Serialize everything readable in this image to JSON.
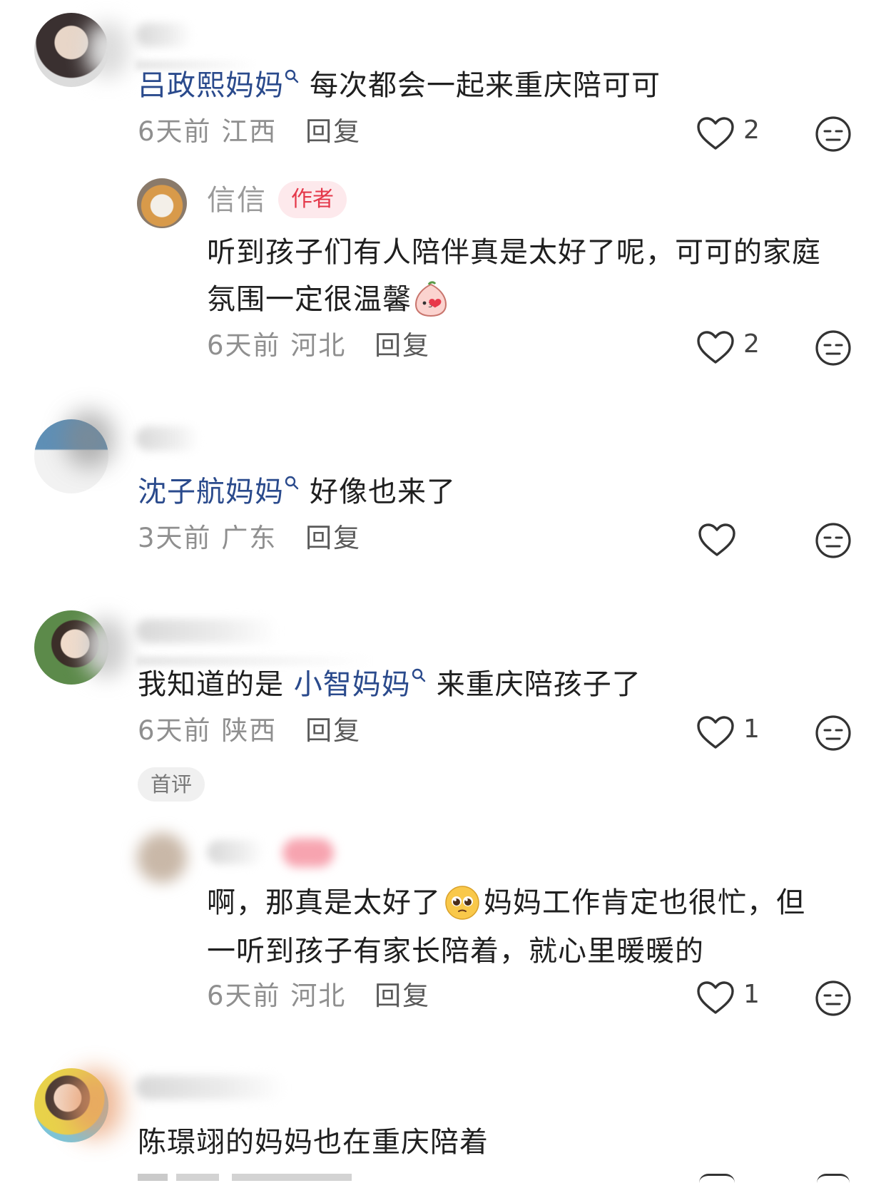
{
  "comments": [
    {
      "mention": "吕政熙妈妈",
      "text": "每次都会一起来重庆陪可可",
      "time": "6天前",
      "location": "江西",
      "reply_label": "回复",
      "likes": "2",
      "reply": {
        "author": "信信",
        "badge": "作者",
        "line1": "听到孩子们有人陪伴真是太好了呢，可可的家庭",
        "line2": "氛围一定很温馨",
        "time": "6天前",
        "location": "河北",
        "reply_label": "回复",
        "likes": "2"
      }
    },
    {
      "mention": "沈子航妈妈",
      "text": "好像也来了",
      "time": "3天前",
      "location": "广东",
      "reply_label": "回复",
      "likes": ""
    },
    {
      "prefix": "我知道的是",
      "mention": "小智妈妈",
      "text": "来重庆陪孩子了",
      "time": "6天前",
      "location": "陕西",
      "reply_label": "回复",
      "likes": "1",
      "first_badge": "首评",
      "reply": {
        "line1a": "啊，那真是太好了",
        "line1b": "妈妈工作肯定也很忙，但",
        "line2": "一听到孩子有家长陪着，就心里暖暖的",
        "time": "6天前",
        "location": "河北",
        "reply_label": "回复",
        "likes": "1"
      }
    },
    {
      "text": "陈璟翊的妈妈也在重庆陪着"
    }
  ],
  "icons": {
    "like": "heart-outline-icon",
    "dislike": "neutral-face-icon",
    "search": "search-icon"
  },
  "colors": {
    "mention": "#2a4a8c",
    "author_badge_text": "#e4384a",
    "author_badge_bg": "#fde9ec",
    "meta": "#8f8f8f"
  }
}
